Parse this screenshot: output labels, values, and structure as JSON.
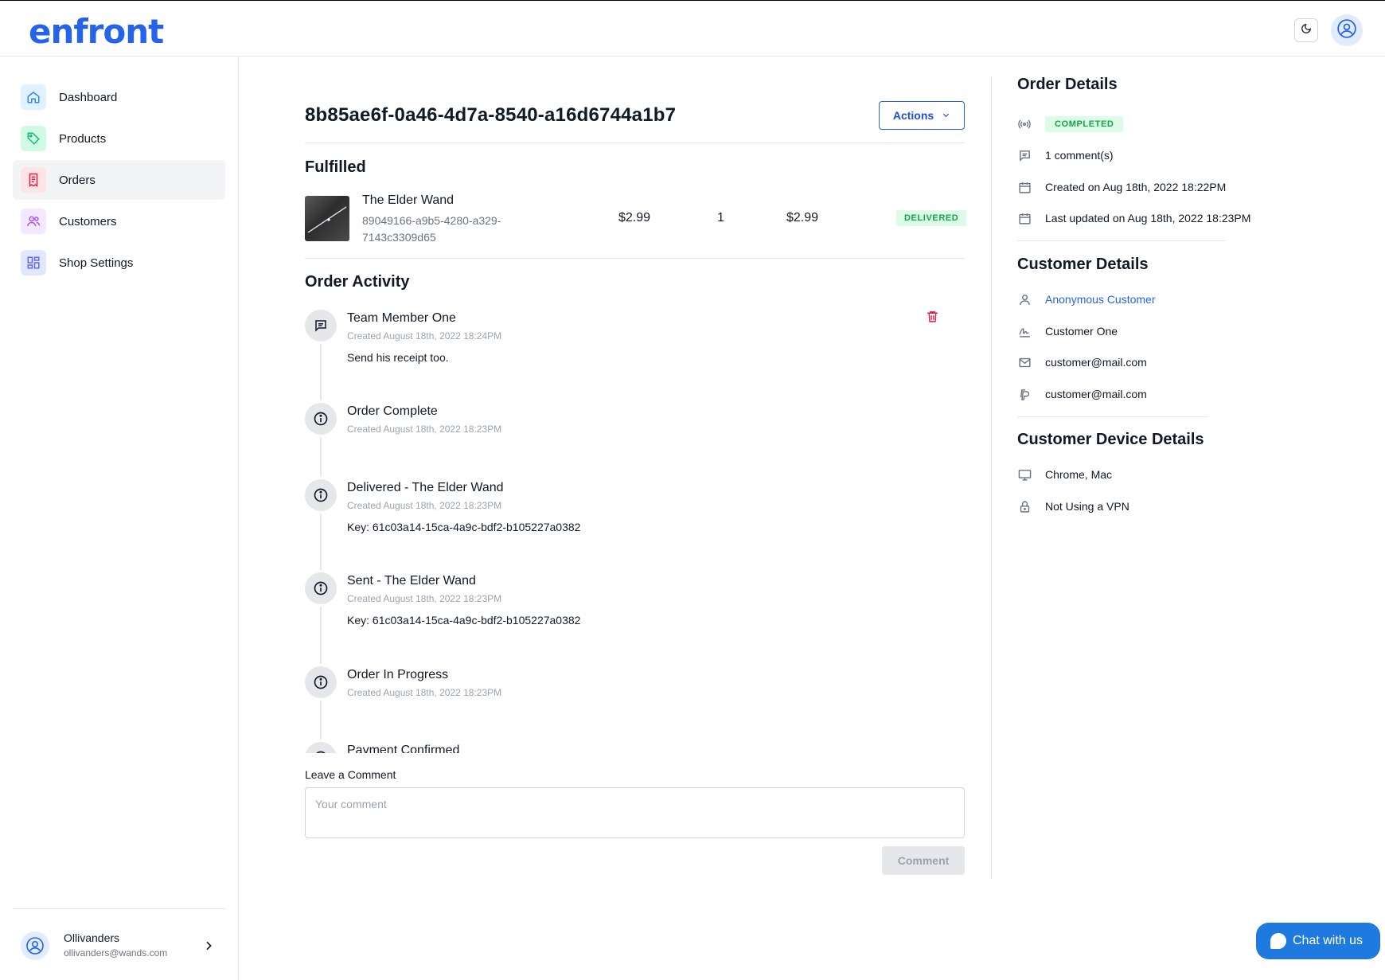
{
  "app": {
    "logo": "enfront"
  },
  "sidebar": {
    "items": [
      {
        "label": "Dashboard",
        "icon": "home-icon",
        "color": "#3b82f6",
        "bg": "#e0f2fe"
      },
      {
        "label": "Products",
        "icon": "tag-icon",
        "color": "#10b981",
        "bg": "#d1fae5"
      },
      {
        "label": "Orders",
        "icon": "receipt-icon",
        "color": "#e11d48",
        "bg": "#ffe4e6",
        "active": true
      },
      {
        "label": "Customers",
        "icon": "users-icon",
        "color": "#a855f7",
        "bg": "#f3e8ff"
      },
      {
        "label": "Shop Settings",
        "icon": "grid-icon",
        "color": "#6366f1",
        "bg": "#e0e7ff"
      }
    ],
    "account": {
      "name": "Ollivanders",
      "email": "ollivanders@wands.com"
    }
  },
  "order": {
    "id": "8b85ae6f-0a46-4d7a-8540-a16d6744a1b7",
    "actions_label": "Actions",
    "fulfilled_heading": "Fulfilled",
    "item": {
      "name": "The Elder Wand",
      "id": "89049166-a9b5-4280-a329-7143c3309d65",
      "unit_price": "$2.99",
      "quantity": "1",
      "total": "$2.99",
      "status": "DELIVERED"
    },
    "activity_heading": "Order Activity",
    "activity": [
      {
        "title": "Team Member One",
        "date": "Created August 18th, 2022 18:24PM",
        "body": "Send his receipt too.",
        "icon": "comment-icon"
      },
      {
        "title": "Order Complete",
        "date": "Created August 18th, 2022 18:23PM",
        "body": "",
        "icon": "info-icon"
      },
      {
        "title": "Delivered - The Elder Wand",
        "date": "Created August 18th, 2022 18:23PM",
        "body": "Key: 61c03a14-15ca-4a9c-bdf2-b105227a0382",
        "icon": "info-icon"
      },
      {
        "title": "Sent - The Elder Wand",
        "date": "Created August 18th, 2022 18:23PM",
        "body": "Key: 61c03a14-15ca-4a9c-bdf2-b105227a0382",
        "icon": "info-icon"
      },
      {
        "title": "Order In Progress",
        "date": "Created August 18th, 2022 18:23PM",
        "body": "",
        "icon": "info-icon"
      },
      {
        "title": "Payment Confirmed",
        "date": "",
        "body": "",
        "icon": "info-icon"
      }
    ],
    "comment": {
      "label": "Leave a Comment",
      "placeholder": "Your comment",
      "button": "Comment"
    }
  },
  "details": {
    "order_heading": "Order Details",
    "status": "COMPLETED",
    "comments": "1 comment(s)",
    "created": "Created on Aug 18th, 2022 18:22PM",
    "updated": "Last updated on Aug 18th, 2022 18:23PM",
    "customer_heading": "Customer Details",
    "customer_type": "Anonymous Customer",
    "customer_name": "Customer One",
    "customer_email": "customer@mail.com",
    "customer_paypal": "customer@mail.com",
    "device_heading": "Customer Device Details",
    "device": "Chrome, Mac",
    "vpn": "Not Using a VPN"
  },
  "chat": {
    "label": "Chat with us"
  }
}
